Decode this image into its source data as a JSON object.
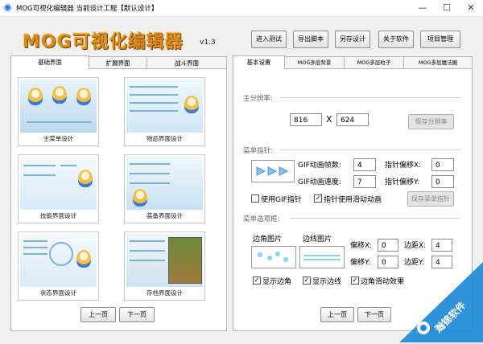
{
  "window": {
    "title": "MOG可视化编辑器  当前设计工程【默认设计】",
    "minimize": "—",
    "maximize": "☐",
    "close": "✕"
  },
  "header": {
    "logo_text": "MOG可视化编辑器",
    "version": "v1.3",
    "buttons": [
      "进入测试",
      "导出脚本",
      "另存设计",
      "关于软件",
      "项目管理"
    ]
  },
  "left_panel": {
    "tabs": [
      "基础界面",
      "扩展界面",
      "战斗界面"
    ],
    "active_tab": 0,
    "thumbnails": [
      "主菜单设计",
      "物品界面设计",
      "技能界面设计",
      "装备界面设计",
      "状态界面设计",
      "存档界面设计"
    ],
    "prev_label": "上一页",
    "next_label": "下一页"
  },
  "right_panel": {
    "tabs": [
      "基本设置",
      "MOG多层背景",
      "MOG多层粒子",
      "MOG多层魔法圈"
    ],
    "active_tab": 0,
    "resolution": {
      "title": "主分辨率:",
      "width": "816",
      "separator": "X",
      "height": "624",
      "save_label": "保存分辨率"
    },
    "cursor": {
      "title": "菜单指针:",
      "gif_frames_label": "GIF动画帧数:",
      "gif_frames": "4",
      "gif_speed_label": "GIF动画速度:",
      "gif_speed": "7",
      "offset_x_label": "指针偏移X:",
      "offset_x": "0",
      "offset_y_label": "指针偏移Y:",
      "offset_y": "0",
      "use_gif_label": "使用GIF指针",
      "use_gif_checked": false,
      "slide_anim_label": "指针使用滑动动画",
      "slide_anim_checked": true,
      "save_label": "保存菜单指针"
    },
    "menu_frame": {
      "title": "菜单选项框:",
      "corner_img_label": "边角图片",
      "edge_img_label": "边线图片",
      "offset_x_label": "偏移X:",
      "offset_x": "0",
      "offset_y_label": "偏移Y:",
      "offset_y": "0",
      "spacing_x_label": "边距X:",
      "spacing_x": "4",
      "spacing_y_label": "边距Y:",
      "spacing_y": "4",
      "show_corner_label": "显示边角",
      "show_corner_checked": true,
      "show_edge_label": "显示边线",
      "show_edge_checked": true,
      "corner_slide_label": "边角滑动效果",
      "corner_slide_checked": true
    },
    "prev_label": "上一页",
    "next_label": "下一页"
  },
  "watermark": {
    "text": "瀚锦软件",
    "color": "#1e8ad6"
  }
}
